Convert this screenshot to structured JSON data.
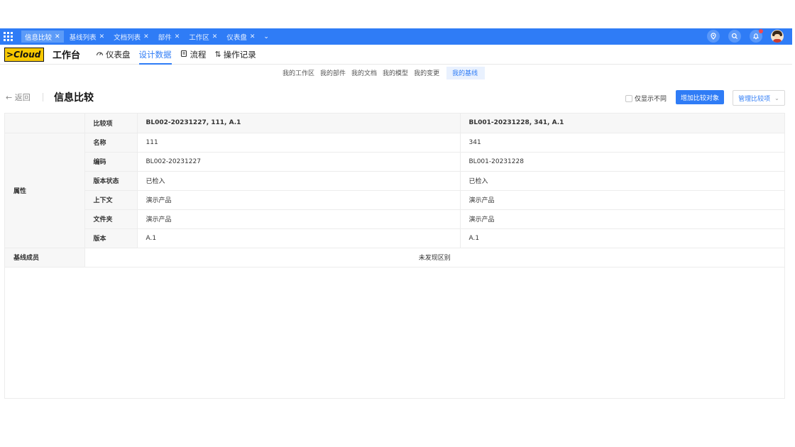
{
  "tabs": [
    {
      "label": "信息比较",
      "active": true
    },
    {
      "label": "基线列表",
      "active": false
    },
    {
      "label": "文档列表",
      "active": false
    },
    {
      "label": "部件",
      "active": false
    },
    {
      "label": "工作区",
      "active": false
    },
    {
      "label": "仪表盘",
      "active": false
    }
  ],
  "top_icons": [
    "location-icon",
    "search-icon",
    "bell-icon",
    "avatar"
  ],
  "app": {
    "logo": "Cloud",
    "workbench": "工作台",
    "nav": [
      {
        "label": "仪表盘",
        "icon": "dashboard-icon",
        "active": false
      },
      {
        "label": "设计数据",
        "icon": "",
        "active": true
      },
      {
        "label": "流程",
        "icon": "workflow-icon",
        "active": false
      },
      {
        "label": "操作记录",
        "icon": "sort-icon",
        "active": false
      }
    ]
  },
  "subnav": [
    {
      "label": "我的工作区",
      "active": false
    },
    {
      "label": "我的部件",
      "active": false
    },
    {
      "label": "我的文档",
      "active": false
    },
    {
      "label": "我的模型",
      "active": false
    },
    {
      "label": "我的变更",
      "active": false
    },
    {
      "label": "我的基线",
      "active": true
    }
  ],
  "page": {
    "back": "← 返回",
    "title": "信息比较",
    "only_diff_label": "仅显示不同",
    "add_button": "增加比较对象",
    "manage_button": "管理比较项"
  },
  "table": {
    "header": {
      "label": "比较项",
      "a": "BL002-20231227, 111, A.1",
      "b": "BL001-20231228, 341, A.1"
    },
    "group_label": "属性",
    "rows": [
      {
        "label": "名称",
        "a": "111",
        "b": "341"
      },
      {
        "label": "编码",
        "a": "BL002-20231227",
        "b": "BL001-20231228"
      },
      {
        "label": "版本状态",
        "a": "已检入",
        "b": "已检入"
      },
      {
        "label": "上下文",
        "a": "演示产品",
        "b": "演示产品"
      },
      {
        "label": "文件夹",
        "a": "演示产品",
        "b": "演示产品"
      },
      {
        "label": "版本",
        "a": "A.1",
        "b": "A.1"
      }
    ],
    "members": {
      "label": "基线成员",
      "value": "未发现区别"
    }
  },
  "colors": {
    "primary": "#2f7cf6",
    "tabbar": "#2f7cf6",
    "logo_bg": "#f7c800"
  }
}
